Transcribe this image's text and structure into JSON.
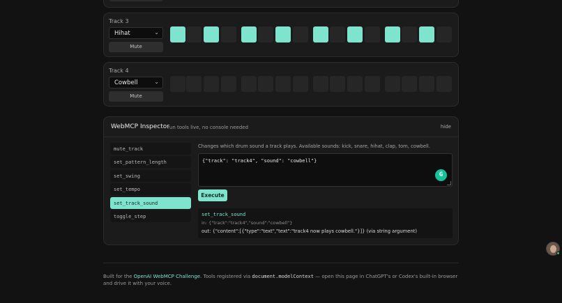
{
  "tracks": [
    {
      "label": "Track 3",
      "sound": "Hihat",
      "mute_label": "Mute",
      "steps": [
        1,
        0,
        1,
        0,
        1,
        0,
        1,
        0,
        1,
        0,
        1,
        0,
        1,
        0,
        1,
        0
      ]
    },
    {
      "label": "Track 4",
      "sound": "Cowbell",
      "mute_label": "Mute",
      "steps": [
        0,
        0,
        0,
        0,
        0,
        0,
        0,
        0,
        0,
        0,
        0,
        0,
        0,
        0,
        0,
        0
      ]
    }
  ],
  "inspector": {
    "title": "WebMCP Inspector",
    "subtitle": "run tools live, no console needed",
    "hide_label": "hide",
    "tools": [
      "mute_track",
      "set_pattern_length",
      "set_swing",
      "set_tempo",
      "set_track_sound",
      "toggle_step"
    ],
    "active_tool": "set_track_sound",
    "description": "Changes which drum sound a track plays. Available sounds: kick, snare, hihat, clap, tom, cowbell.",
    "args": "{\"track\": \"track4\", \"sound\": \"cowbell\"}",
    "execute_label": "Execute",
    "result": {
      "name": "set_track_sound",
      "in": "in: {\"track\":\"track4\",\"sound\":\"cowbell\"}",
      "out": "out: {\"content\":[{\"type\":\"text\",\"text\":\"track4 now plays cowbell.\"}]} (via string argument)"
    }
  },
  "footer": {
    "prefix": "Built for the ",
    "link": "OpenAI WebMCP Challenge",
    "middle": ". Tools registered via ",
    "code": "document.modelContext",
    "suffix": " — open this page in ChatGPT's or Codex's built-in browser and drive it with your voice."
  },
  "colors": {
    "accent": "#7ee4cd",
    "background": "#121212",
    "panel": "#1b1b1b"
  }
}
